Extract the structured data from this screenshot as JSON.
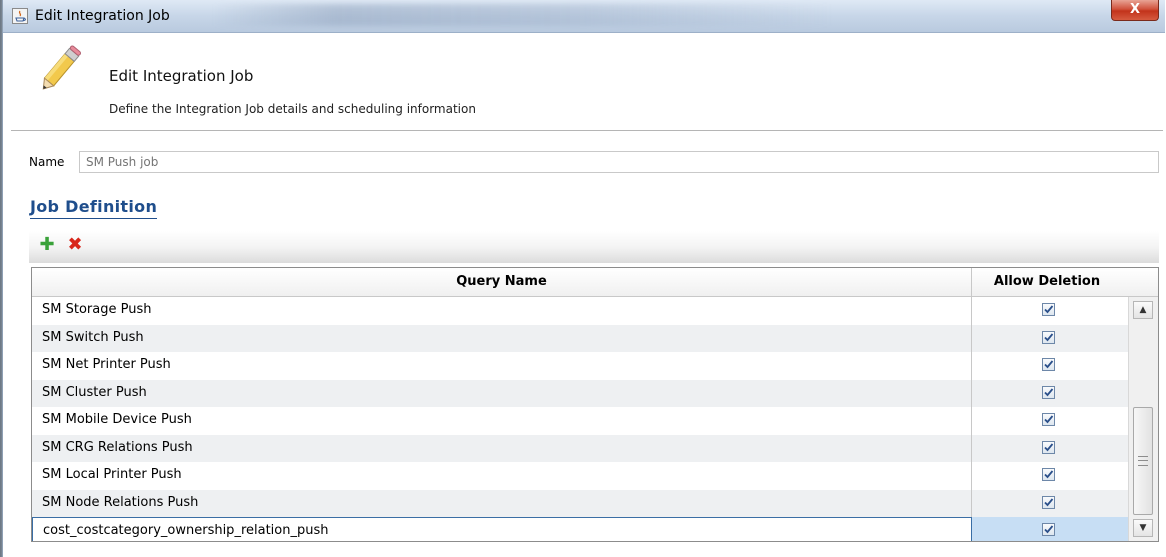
{
  "window": {
    "title": "Edit Integration Job",
    "close_label": "X"
  },
  "header": {
    "title": "Edit Integration Job",
    "subtitle": "Define the Integration Job details and scheduling information",
    "icon": "pencil-icon"
  },
  "form": {
    "name_label": "Name",
    "name_value": "",
    "name_placeholder": "SM Push job"
  },
  "job_definition": {
    "heading": "Job Definition",
    "toolbar": {
      "add_icon": "plus-icon",
      "add_glyph": "✚",
      "delete_icon": "delete-x-icon",
      "delete_glyph": "✖"
    },
    "table": {
      "columns": [
        "Query Name",
        "Allow Deletion"
      ],
      "rows": [
        {
          "query_name": "SM Storage Push",
          "allow_deletion": true
        },
        {
          "query_name": "SM Switch Push",
          "allow_deletion": true
        },
        {
          "query_name": "SM Net Printer Push",
          "allow_deletion": true
        },
        {
          "query_name": "SM Cluster Push",
          "allow_deletion": true
        },
        {
          "query_name": "SM Mobile Device Push",
          "allow_deletion": true
        },
        {
          "query_name": "SM CRG Relations Push",
          "allow_deletion": true
        },
        {
          "query_name": "SM Local Printer Push",
          "allow_deletion": true
        },
        {
          "query_name": "SM Node Relations Push",
          "allow_deletion": true
        },
        {
          "query_name": "cost_costcategory_ownership_relation_push",
          "allow_deletion": true,
          "selected": true
        }
      ]
    },
    "scrollbar": {
      "up_glyph": "▲",
      "down_glyph": "▼"
    }
  },
  "colors": {
    "heading": "#1f4e8c",
    "selection": "#c7def4",
    "add": "#3aa23a",
    "delete": "#d8261a"
  }
}
